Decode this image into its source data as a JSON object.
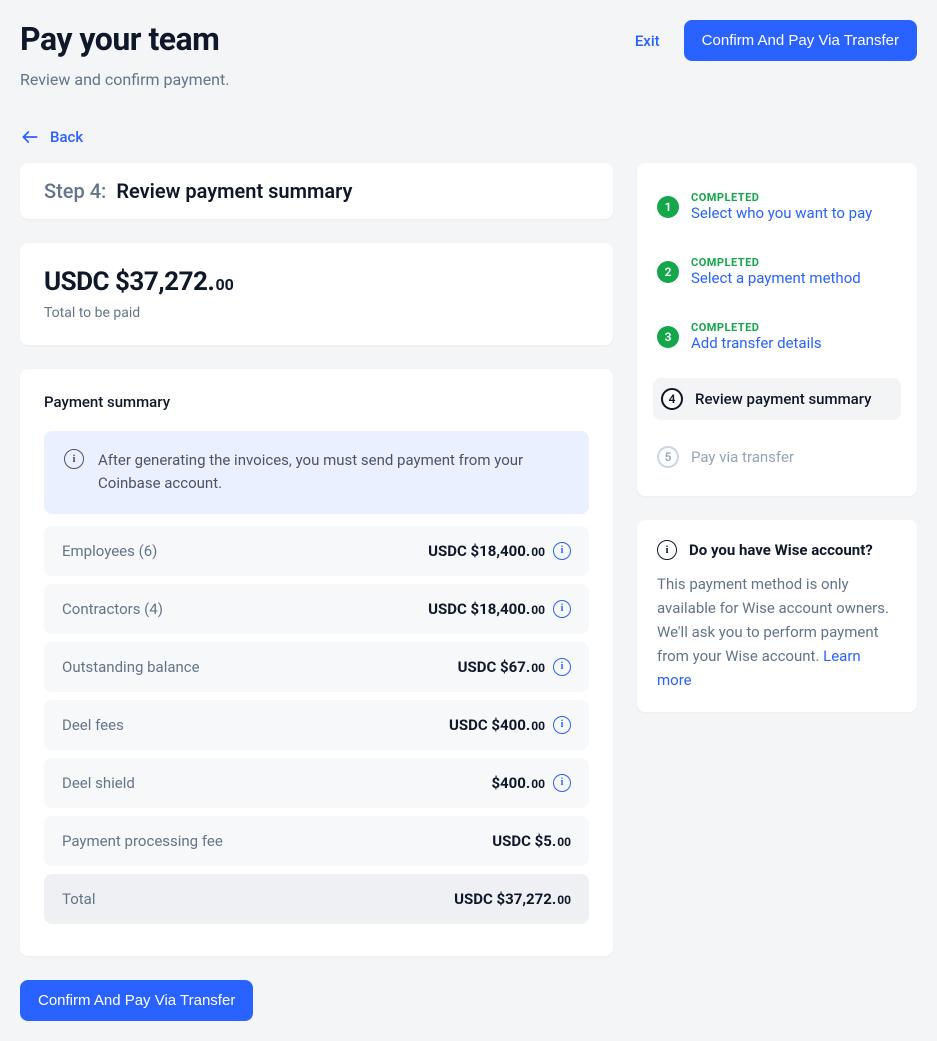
{
  "header": {
    "title": "Pay your team",
    "subtitle": "Review and confirm payment.",
    "exit_label": "Exit",
    "confirm_label": "Confirm And Pay Via Transfer"
  },
  "back_label": "Back",
  "step_header": {
    "prefix": "Step 4:",
    "title": "Review payment summary"
  },
  "total": {
    "main": "USDC $37,272.",
    "cents": "00",
    "caption": "Total to be paid"
  },
  "summary": {
    "heading": "Payment summary",
    "banner": "After generating the invoices, you must send payment from your Coinbase account.",
    "items": [
      {
        "label": "Employees (6)",
        "value_main": "USDC $18,400.",
        "value_cents": "00",
        "has_info": true
      },
      {
        "label": "Contractors (4)",
        "value_main": "USDC $18,400.",
        "value_cents": "00",
        "has_info": true
      },
      {
        "label": "Outstanding balance",
        "value_main": "USDC $67.",
        "value_cents": "00",
        "has_info": true
      },
      {
        "label": "Deel fees",
        "value_main": "USDC $400.",
        "value_cents": "00",
        "has_info": true
      },
      {
        "label": "Deel shield",
        "value_main": "$400.",
        "value_cents": "00",
        "has_info": true
      },
      {
        "label": "Payment processing fee",
        "value_main": "USDC $5.",
        "value_cents": "00",
        "has_info": false
      }
    ],
    "total_row": {
      "label": "Total",
      "value_main": "USDC $37,272.",
      "value_cents": "00"
    }
  },
  "confirm_button_bottom": "Confirm And Pay Via Transfer",
  "stepper": [
    {
      "num": "1",
      "status": "COMPLETED",
      "label": "Select who you want to pay",
      "state": "done"
    },
    {
      "num": "2",
      "status": "COMPLETED",
      "label": "Select a payment method",
      "state": "done"
    },
    {
      "num": "3",
      "status": "COMPLETED",
      "label": "Add transfer details",
      "state": "done"
    },
    {
      "num": "4",
      "status": "",
      "label": "Review payment summary",
      "state": "current"
    },
    {
      "num": "5",
      "status": "",
      "label": "Pay via transfer",
      "state": "pending"
    }
  ],
  "wise": {
    "title": "Do you have Wise account?",
    "body": "This payment method is only available for Wise account owners. We'll ask you to perform payment from your Wise account. ",
    "link": "Learn more"
  }
}
